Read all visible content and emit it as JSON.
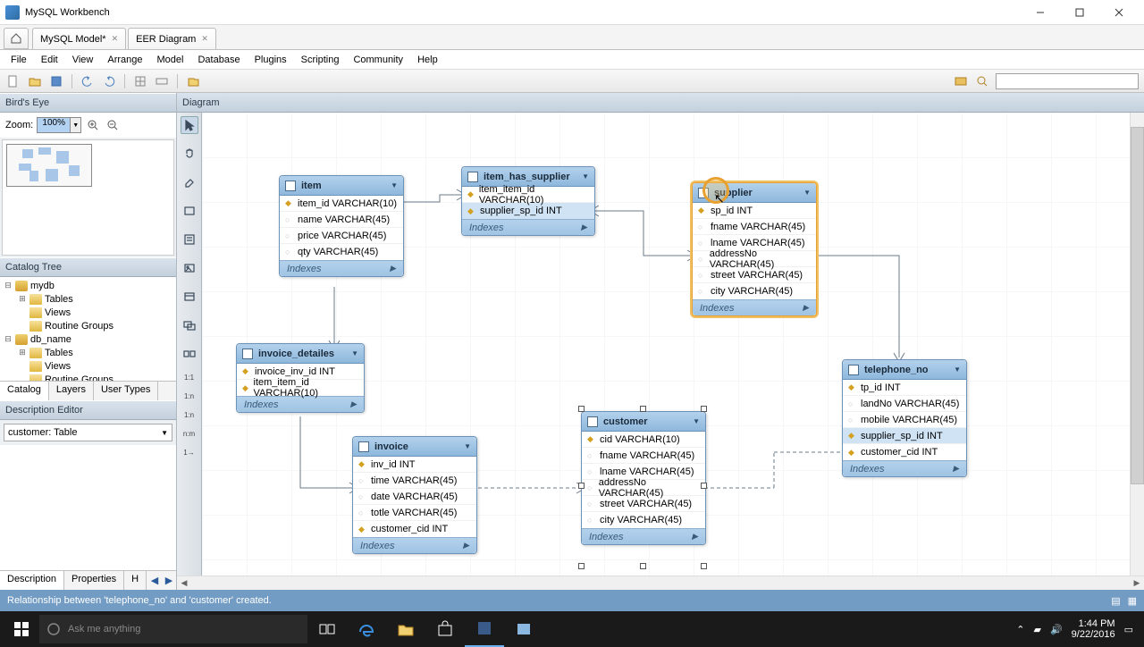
{
  "app_title": "MySQL Workbench",
  "tabs": [
    {
      "label": "MySQL Model*"
    },
    {
      "label": "EER Diagram"
    }
  ],
  "menus": [
    "File",
    "Edit",
    "View",
    "Arrange",
    "Model",
    "Database",
    "Plugins",
    "Scripting",
    "Community",
    "Help"
  ],
  "panels": {
    "birdseye": "Bird's Eye",
    "zoom_label": "Zoom:",
    "zoom_value": "100%",
    "catalog": "Catalog Tree",
    "desc": "Description Editor",
    "diagram": "Diagram"
  },
  "catalog": {
    "db1": "mydb",
    "db2": "db_name",
    "tables": "Tables",
    "views": "Views",
    "routines": "Routine Groups"
  },
  "side_tabs": {
    "catalog": "Catalog",
    "layers": "Layers",
    "usertypes": "User Types"
  },
  "desc_select": "customer:  Table",
  "bottom_tabs": {
    "description": "Description",
    "properties": "Properties",
    "history": "H"
  },
  "indexes_label": "Indexes",
  "tables": {
    "item": {
      "name": "item",
      "cols": [
        {
          "n": "item_id VARCHAR(10)",
          "pk": true
        },
        {
          "n": "name VARCHAR(45)"
        },
        {
          "n": "price VARCHAR(45)"
        },
        {
          "n": "qty VARCHAR(45)"
        }
      ]
    },
    "item_has_supplier": {
      "name": "item_has_supplier",
      "cols": [
        {
          "n": "item_item_id VARCHAR(10)",
          "pk": true
        },
        {
          "n": "supplier_sp_id INT",
          "pk": true,
          "fk": true
        }
      ]
    },
    "supplier": {
      "name": "supplier",
      "cols": [
        {
          "n": "sp_id INT",
          "pk": true
        },
        {
          "n": "fname VARCHAR(45)"
        },
        {
          "n": "lname VARCHAR(45)"
        },
        {
          "n": "addressNo VARCHAR(45)"
        },
        {
          "n": "street VARCHAR(45)"
        },
        {
          "n": "city VARCHAR(45)"
        }
      ]
    },
    "invoice_detailes": {
      "name": "invoice_detailes",
      "cols": [
        {
          "n": "invoice_inv_id INT",
          "pk": true
        },
        {
          "n": "item_item_id VARCHAR(10)",
          "pk": true
        }
      ]
    },
    "invoice": {
      "name": "invoice",
      "cols": [
        {
          "n": "inv_id INT",
          "pk": true
        },
        {
          "n": "time VARCHAR(45)"
        },
        {
          "n": "date VARCHAR(45)"
        },
        {
          "n": "totle VARCHAR(45)"
        },
        {
          "n": "customer_cid INT",
          "pk": true
        }
      ]
    },
    "customer": {
      "name": "customer",
      "cols": [
        {
          "n": "cid VARCHAR(10)",
          "pk": true
        },
        {
          "n": "fname VARCHAR(45)"
        },
        {
          "n": "lname VARCHAR(45)"
        },
        {
          "n": "addressNo VARCHAR(45)"
        },
        {
          "n": "street VARCHAR(45)"
        },
        {
          "n": "city VARCHAR(45)"
        }
      ]
    },
    "telephone_no": {
      "name": "telephone_no",
      "cols": [
        {
          "n": "tp_id INT",
          "pk": true
        },
        {
          "n": "landNo VARCHAR(45)"
        },
        {
          "n": "mobile VARCHAR(45)"
        },
        {
          "n": "supplier_sp_id INT",
          "fk": true,
          "pk": true
        },
        {
          "n": "customer_cid INT",
          "pk": true
        }
      ]
    }
  },
  "rel_labels": [
    "1:1",
    "1:n",
    "1:n",
    "n:m",
    "1→"
  ],
  "status": "Relationship between 'telephone_no' and 'customer' created.",
  "cortana": "Ask me anything",
  "clock": {
    "time": "1:44 PM",
    "date": "9/22/2016"
  }
}
